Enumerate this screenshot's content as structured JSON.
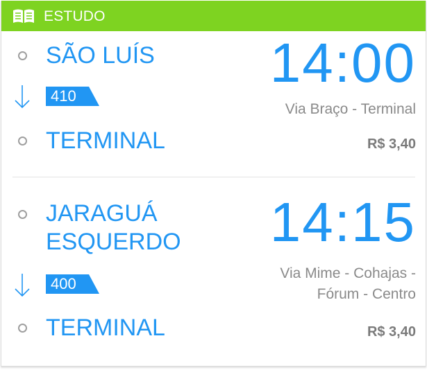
{
  "header": {
    "title": "ESTUDO",
    "icon": "book-icon",
    "color": "#7ed321"
  },
  "trips": [
    {
      "origin": "SÃO LUÍS",
      "route_number": "410",
      "destination": "TERMINAL",
      "time": "14:00",
      "via": "Via Braço - Terminal",
      "price": "R$ 3,40"
    },
    {
      "origin_line1": "JARAGUÁ",
      "origin_line2": "ESQUERDO",
      "route_number": "400",
      "destination": "TERMINAL",
      "time": "14:15",
      "via_line1": "Via Mime - Cohajas -",
      "via_line2": "Fórum - Centro",
      "price": "R$ 3,40"
    }
  ],
  "colors": {
    "accent": "#2196f3",
    "muted": "#8a8a8a"
  }
}
